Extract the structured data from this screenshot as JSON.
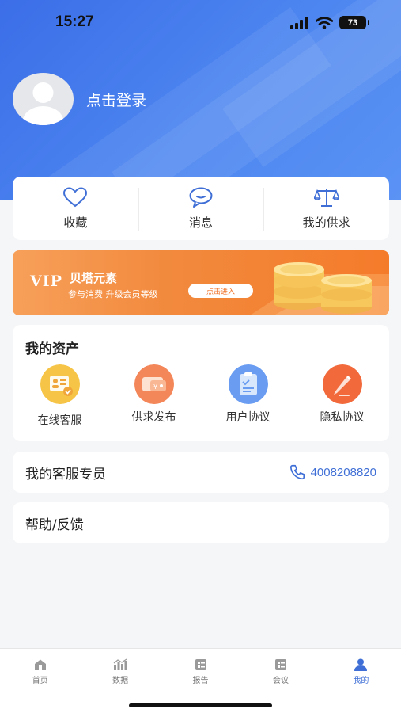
{
  "status_bar": {
    "time": "15:27",
    "battery": "73"
  },
  "profile": {
    "login_text": "点击登录"
  },
  "quick_actions": [
    {
      "label": "收藏",
      "icon": "heart-icon"
    },
    {
      "label": "消息",
      "icon": "message-icon"
    },
    {
      "label": "我的供求",
      "icon": "scale-icon"
    }
  ],
  "vip": {
    "tag": "VIP",
    "title": "贝塔元素",
    "subtitle": "参与消费 升级会员等级",
    "button": "点击进入"
  },
  "assets": {
    "title": "我的资产",
    "items": [
      {
        "label": "在线客服",
        "icon": "customer-service-icon"
      },
      {
        "label": "供求发布",
        "icon": "wallet-icon"
      },
      {
        "label": "用户协议",
        "icon": "clipboard-icon"
      },
      {
        "label": "隐私协议",
        "icon": "pen-icon"
      }
    ]
  },
  "service": {
    "title": "我的客服专员",
    "phone": "4008208820"
  },
  "help": {
    "title": "帮助/反馈"
  },
  "tab_bar": {
    "active": 4,
    "items": [
      {
        "label": "首页",
        "icon": "home-icon"
      },
      {
        "label": "数据",
        "icon": "chart-icon"
      },
      {
        "label": "报告",
        "icon": "report-icon"
      },
      {
        "label": "会议",
        "icon": "meeting-icon"
      },
      {
        "label": "我的",
        "icon": "user-icon"
      }
    ]
  },
  "colors": {
    "primary": "#3f6fd6",
    "header": "#4a80ee",
    "vip": "#f28a3e"
  }
}
